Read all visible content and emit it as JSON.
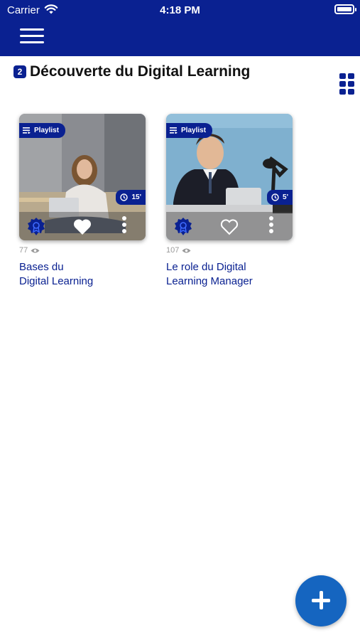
{
  "status_bar": {
    "carrier": "Carrier",
    "time": "4:18 PM"
  },
  "section": {
    "count": "2",
    "title": "Découverte du Digital Learning"
  },
  "colors": {
    "primary": "#0a2191",
    "fab": "#1565c0",
    "meta_gray": "#9a9a9a"
  },
  "cards": [
    {
      "badge": "Playlist",
      "duration": "15'",
      "views": "77",
      "title_line1": "Bases du",
      "title_line2": "Digital Learning",
      "liked": true,
      "icons": [
        "playlist-icon",
        "clock-icon",
        "award-icon",
        "heart-filled-icon",
        "more-vertical-icon",
        "eye-icon"
      ]
    },
    {
      "badge": "Playlist",
      "duration": "5'",
      "views": "107",
      "title_line1": "Le role du Digital",
      "title_line2": "Learning Manager",
      "liked": false,
      "icons": [
        "playlist-icon",
        "clock-icon",
        "award-icon",
        "heart-outline-icon",
        "more-vertical-icon",
        "eye-icon"
      ]
    }
  ],
  "fab": {
    "icon": "plus-icon"
  }
}
